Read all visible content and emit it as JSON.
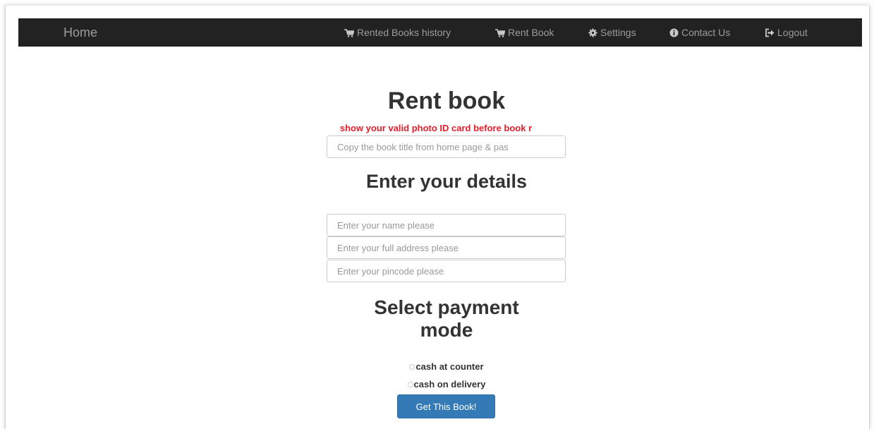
{
  "nav": {
    "brand": "Home",
    "items": [
      {
        "label": "Rented Books history",
        "icon": "cart-icon"
      },
      {
        "label": "Rent Book",
        "icon": "cart-icon"
      },
      {
        "label": "Settings",
        "icon": "gear-icon"
      },
      {
        "label": "Contact Us",
        "icon": "info-circle-icon"
      },
      {
        "label": "Logout",
        "icon": "logout-icon"
      }
    ]
  },
  "main": {
    "title": "Rent book",
    "warning": "show your valid photo ID card before book r",
    "book_title_placeholder": "Copy the book title from home page & pas",
    "details_heading": "Enter your details",
    "name_placeholder": "Enter your name please",
    "address_placeholder": "Enter your full address please",
    "pincode_placeholder": "Enter your pincode please",
    "payment_heading_line1": "Select payment",
    "payment_heading_line2": "mode",
    "payment_options": [
      "cash at counter",
      "cash on delivery"
    ],
    "submit_label": "Get This Book!"
  },
  "colors": {
    "navbar": "#222222",
    "nav_text": "#9d9d9d",
    "warning": "#e31e2b",
    "primary_button": "#337ab7"
  }
}
